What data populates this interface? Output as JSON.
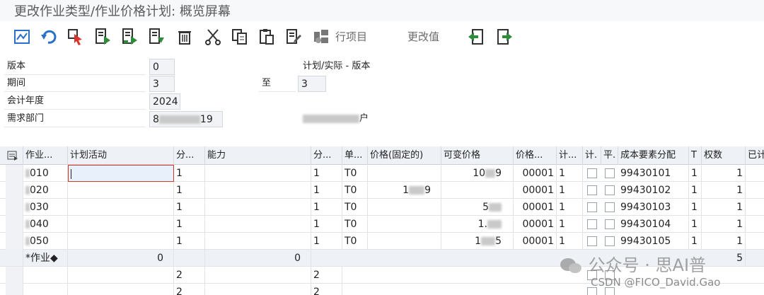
{
  "title": "更改作业类型/作业价格计划: 概览屏幕",
  "toolbar": {
    "icons": [
      "change-icon",
      "undo-icon",
      "select-icon",
      "sort-asc-icon",
      "sort-desc-icon",
      "filter-icon",
      "delete-icon",
      "cut-icon",
      "copy-icon",
      "paste-icon",
      "edit-icon",
      "line-items-icon",
      "prev-icon",
      "next-icon"
    ],
    "line_items_label": "行项目",
    "change_value_label": "更改值"
  },
  "header": {
    "version_label": "版本",
    "version_value": "0",
    "plan_actual_label": "计划/实际 - 版本",
    "period_label": "期间",
    "period_from": "3",
    "to_label": "至",
    "period_to": "3",
    "fiscal_year_label": "会计年度",
    "fiscal_year_value": "2024",
    "dept_label": "需求部门",
    "dept_value_start": "8",
    "dept_value_end": "19",
    "dept_desc_end": "户"
  },
  "table": {
    "columns": [
      "作业...",
      "计划活动",
      "分...",
      "能力",
      "分...",
      "单...",
      "价格(固定的)",
      "可变价格",
      "价格...",
      "计...",
      "计.",
      "平.",
      "成本要素分配",
      "T",
      "权数",
      "已计"
    ],
    "rows": [
      {
        "activity": "010",
        "dist1": "1",
        "dist2": "1",
        "unit": "T0",
        "fixed": "",
        "var_start": "10",
        "var_end": "9",
        "price_unit": "00001",
        "plan_ind": "1",
        "cost_element": "99430101",
        "t": "1",
        "weight": "1"
      },
      {
        "activity": "020",
        "dist1": "1",
        "dist2": "1",
        "unit": "T0",
        "fixed_start": "1",
        "fixed_end": "9",
        "var_start": "",
        "var_end": "",
        "price_unit": "00001",
        "plan_ind": "1",
        "cost_element": "99430102",
        "t": "1",
        "weight": "1"
      },
      {
        "activity": "030",
        "dist1": "1",
        "dist2": "1",
        "unit": "T0",
        "fixed": "",
        "var_start": "5",
        "var_end": "",
        "price_unit": "00001",
        "plan_ind": "1",
        "cost_element": "99430103",
        "t": "1",
        "weight": "1"
      },
      {
        "activity": "040",
        "dist1": "1",
        "dist2": "1",
        "unit": "T0",
        "fixed": "",
        "var_start": "1.",
        "var_end": "",
        "price_unit": "00001",
        "plan_ind": "1",
        "cost_element": "99430104",
        "t": "1",
        "weight": "1"
      },
      {
        "activity": "050",
        "dist1": "1",
        "dist2": "1",
        "unit": "T0",
        "fixed": "",
        "var_start": "1",
        "var_end": "5",
        "price_unit": "00001",
        "plan_ind": "1",
        "cost_element": "99430105",
        "t": "1",
        "weight": "1"
      }
    ],
    "sum_row": {
      "label": "*作业◆",
      "dist_total": "0",
      "cap_total": "0",
      "weight_total": "5"
    },
    "extra_rows": [
      {
        "dist1": "2",
        "dist2": "2"
      },
      {
        "dist1": "2",
        "dist2": "2"
      }
    ]
  },
  "watermark": {
    "line1": "公众号 · 思AI普",
    "line2": "CSDN @FICO_David.Gao"
  },
  "colors": {
    "accent_green": "#2e8b3a",
    "accent_blue": "#2a6fc9",
    "focus_red": "#d9342b"
  }
}
